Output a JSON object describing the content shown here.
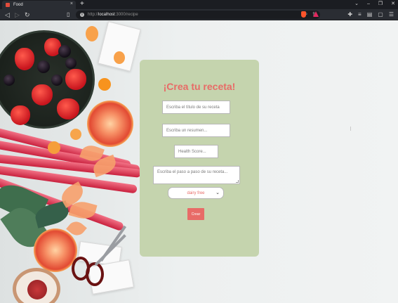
{
  "browser": {
    "tab_title": "Food",
    "tab_close": "×",
    "new_tab": "+",
    "url_scheme": "http://",
    "url_host": "localhost",
    "url_path": ":3000/recipe",
    "window_controls": [
      "⌄",
      "–",
      "❐",
      "✕"
    ]
  },
  "form": {
    "title": "¡Crea tu receta!",
    "title_placeholder": "Escriba el título de su receta",
    "summary_placeholder": "Escriba un resumen...",
    "health_score_placeholder": "Health Score...",
    "steps_placeholder": "Escriba el paso a paso de su receta...",
    "diet_selected": "dairy free",
    "submit_label": "Crear"
  },
  "colors": {
    "card_background": "#c5d4ae",
    "accent": "#e86b67"
  }
}
